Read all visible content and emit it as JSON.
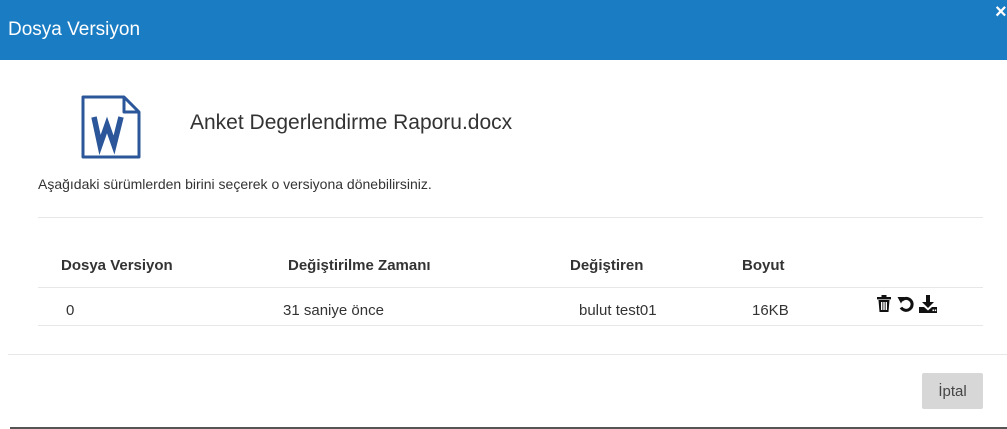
{
  "dialog": {
    "title": "Dosya Versiyon",
    "close_label": "×",
    "file_name": "Anket Degerlendirme Raporu.docx",
    "instruction": "Aşağıdaki sürümlerden birini seçerek o versiyona dönebilirsiniz.",
    "cancel_label": "İptal"
  },
  "table": {
    "headers": [
      "Dosya Versiyon",
      "Değiştirilme Zamanı",
      "Değiştiren",
      "Boyut"
    ],
    "rows": [
      {
        "version": "0",
        "time": "31 saniye önce",
        "changed_by": "bulut test01",
        "size": "16KB"
      }
    ]
  },
  "icons": {
    "file": "word-file-icon",
    "delete": "trash-icon",
    "restore": "restore-icon",
    "download": "download-icon"
  },
  "colors": {
    "header_bg": "#1a7cc2",
    "word_blue": "#2b579a",
    "cancel_bg": "#d7d7d7"
  }
}
